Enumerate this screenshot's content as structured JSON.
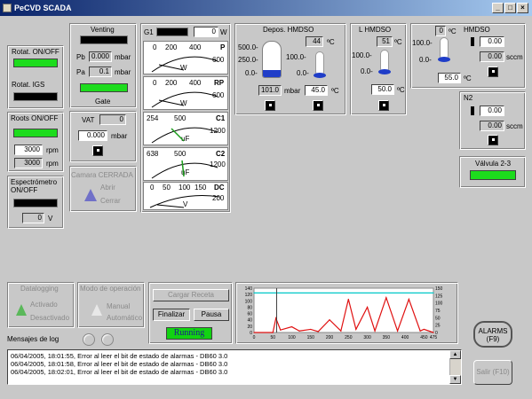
{
  "window": {
    "title": "PeCVD SCADA"
  },
  "left": {
    "rotat_onoff": "Rotat. ON/OFF",
    "rotat_igs": "Rotat. IGS",
    "roots_onoff": "Roots ON/OFF",
    "rpm1": "3000",
    "rpm2": "3000",
    "rpm_unit": "rpm",
    "espec": "Espectrómetro ON/OFF",
    "espec_val": "0",
    "volt": "V"
  },
  "venting": {
    "title": "Venting",
    "pb_label": "Pb",
    "pb_val": "0.000",
    "pa_label": "Pa",
    "pa_val": "0.1",
    "unit": "mbar",
    "gate": "Gate",
    "vat": "VAT",
    "vat_val": "0",
    "vat_mbar": "0.000",
    "vat_unit": "mbar"
  },
  "camera": {
    "title": "Camara CERRADA",
    "open": "Abrir",
    "close": "Cerrar"
  },
  "gauges": {
    "g1": {
      "label": "G1",
      "value": "0",
      "unit": "W"
    },
    "p": {
      "name": "P",
      "t0": "0",
      "t1": "200",
      "t2": "400",
      "t3": "600",
      "unit": "W"
    },
    "rp": {
      "name": "RP",
      "t0": "0",
      "t1": "200",
      "t2": "400",
      "t3": "600",
      "unit": "W"
    },
    "c1": {
      "name": "C1",
      "readout": "254",
      "t1": "500",
      "t3": "1200",
      "unit": "uF"
    },
    "c2": {
      "name": "C2",
      "readout": "638",
      "t1": "500",
      "t3": "1200",
      "unit": "uF"
    },
    "dc": {
      "name": "DC",
      "t0": "0",
      "t1": "50",
      "t2": "100",
      "t3": "150",
      "t4": "200",
      "unit": "V"
    }
  },
  "hmdso": {
    "title": "Depos. HMDSO",
    "temp1": "44",
    "deg": "ºC",
    "s500": "500.0-",
    "s250": "250.0-",
    "s0": "0.0-",
    "s100": "100.0-",
    "s0b": "0.0-",
    "mbar_val": "101.0",
    "mbar": "mbar",
    "temp2": "45.0"
  },
  "lhmdso": {
    "title": "L HMDSO",
    "temp": "51",
    "deg": "ºC",
    "s100": "100.0-",
    "s0": "0.0-",
    "val": "50.0"
  },
  "hmdso2": {
    "title": "HMDSO",
    "temp": "0",
    "deg": "ºC",
    "s100": "100.0-",
    "s0": "0.0-",
    "v1": "0.00",
    "v2": "0.00",
    "sccm": "sccm",
    "val": "55.0"
  },
  "n2": {
    "title": "N2",
    "v1": "0.00",
    "v2": "0.00",
    "sccm": "sccm"
  },
  "valve": {
    "title": "Válvula 2-3"
  },
  "bottom": {
    "datalog": "Datalogging",
    "activado": "Activado",
    "desactivado": "Desactivado",
    "modo": "Modo de operación",
    "manual": "Manual",
    "auto": "Automático",
    "cargar": "Cargar Receta",
    "finalizar": "Finalizar",
    "pausa": "Pausa",
    "running": "Running",
    "mensajes": "Mensajes de log",
    "alarms": "ALARMS\n(F9)",
    "salir": "Salir (F10)"
  },
  "log": [
    "06/04/2005, 18:01:55, Error al leer el bit de estado de alarmas - DB60 3.0",
    "06/04/2005, 18:01:58, Error al leer el bit de estado de alarmas - DB60 3.0",
    "06/04/2005, 18:02:01, Error al leer el bit de estado de alarmas - DB60 3.0"
  ],
  "chart_data": {
    "type": "line",
    "xticks": [
      "0",
      "50",
      "100",
      "150",
      "200",
      "250",
      "300",
      "350",
      "400",
      "450",
      "475"
    ],
    "yticks_left": [
      "140",
      "120",
      "100",
      "80",
      "60",
      "40",
      "20",
      "0"
    ],
    "yticks_right": [
      "150",
      "125",
      "100",
      "75",
      "50",
      "25",
      "0"
    ],
    "series": [
      {
        "color": "#00c8c8",
        "x": [
          0,
          475
        ],
        "y": [
          125,
          125
        ]
      },
      {
        "color": "#e01010",
        "x": [
          0,
          50,
          58,
          70,
          100,
          120,
          150,
          170,
          200,
          230,
          250,
          270,
          300,
          320,
          350,
          380,
          410,
          440,
          450,
          475
        ],
        "y": [
          0,
          0,
          45,
          8,
          18,
          5,
          10,
          3,
          40,
          5,
          105,
          10,
          80,
          5,
          110,
          5,
          105,
          5,
          10,
          0
        ]
      }
    ],
    "cursor_x": 60,
    "xlim": [
      0,
      475
    ],
    "ylim": [
      0,
      140
    ]
  }
}
